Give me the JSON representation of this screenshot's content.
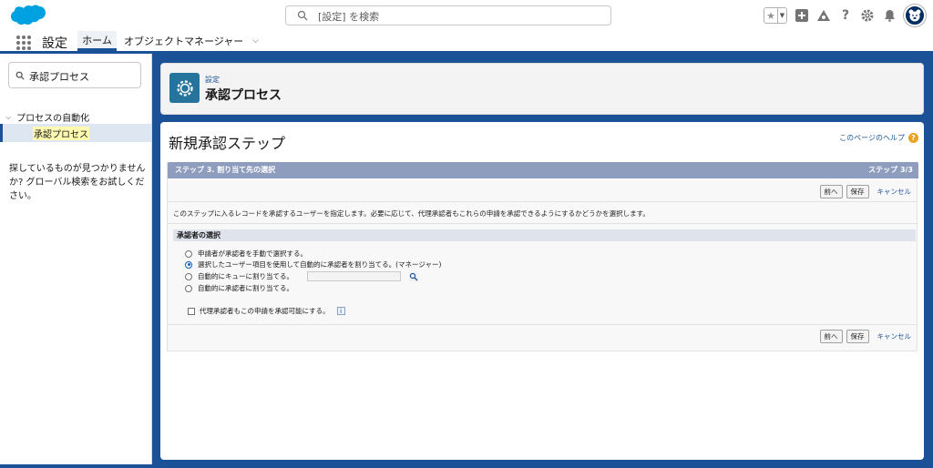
{
  "header": {
    "search_placeholder": "[設定] を検索"
  },
  "app_nav": {
    "app_name": "設定",
    "tabs": [
      {
        "label": "ホーム"
      },
      {
        "label": "オブジェクトマネージャー"
      }
    ]
  },
  "sidebar": {
    "search_value": "承認プロセス",
    "tree_parent": "プロセスの自動化",
    "tree_child": "承認プロセス",
    "no_result_text": "探しているものが見つかりませんか? グローバル検索をお試しください。"
  },
  "page_header": {
    "breadcrumb": "設定",
    "title": "承認プロセス"
  },
  "form": {
    "title": "新規承認ステップ",
    "help_link": "このページのヘルプ",
    "step_title": "ステップ 3. 割り当て先の選択",
    "step_count": "ステップ 3/3",
    "buttons": {
      "prev": "前へ",
      "save": "保存",
      "cancel": "キャンセル"
    },
    "description": "このステップに入るレコードを承認するユーザーを指定します。必要に応じて、代理承認者もこれらの申請を承認できるようにするかどうかを選択します。",
    "section_title": "承認者の選択",
    "options": [
      {
        "label": "申請者が承認者を手動で選択する。",
        "selected": false
      },
      {
        "label": "選択したユーザー項目を使用して自動的に承認者を割り当てる。(マネージャー)",
        "selected": true
      },
      {
        "label": "自動的にキューに割り当てる。",
        "selected": false
      },
      {
        "label": "自動的に承認者に割り当てる。",
        "selected": false
      }
    ],
    "delegate_checkbox": "代理承認者もこの申請を承認可能にする。",
    "delegate_checked": false
  },
  "colors": {
    "brand": "#1b5297",
    "step_header": "#8e9dbe",
    "gear_tile": "#26739c"
  }
}
